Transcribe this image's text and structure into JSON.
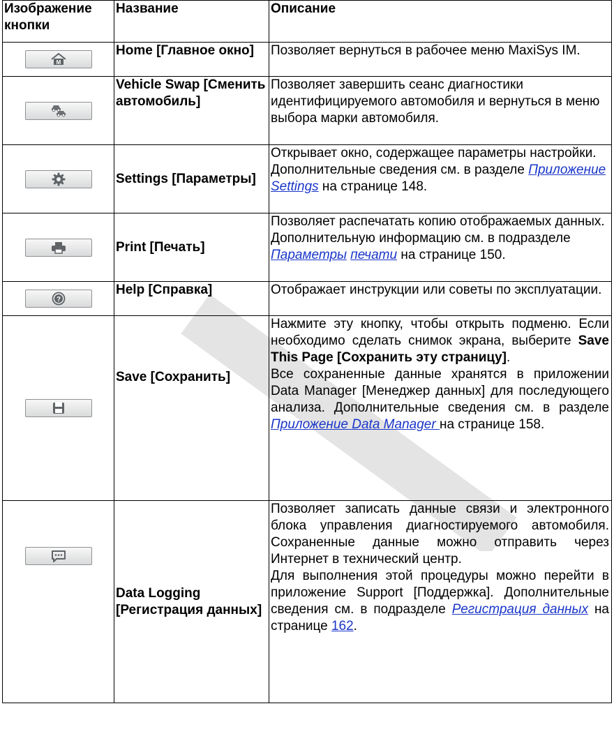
{
  "headers": {
    "image": "Изображение кнопки",
    "name": "Название",
    "desc": "Описание"
  },
  "rows": {
    "home": {
      "icon": "home-icon",
      "name": "Home [Главное окно]",
      "desc": "Позволяет вернуться в рабочее меню MaxiSys IM."
    },
    "vehicle_swap": {
      "icon": "vehicle-swap-icon",
      "name": "Vehicle Swap [Сменить автомобиль]",
      "desc": "Позволяет завершить сеанс диагностики идентифицируемого автомобиля и вернуться в меню выбора марки автомобиля."
    },
    "settings": {
      "icon": "gear-icon",
      "name": "Settings [Параметры]",
      "desc_a": "Открывает окно, содержащее параметры настройки. Дополнительные сведения см. в разделе ",
      "link": "Приложение Settings",
      "desc_b": " на странице 148."
    },
    "print": {
      "icon": "printer-icon",
      "name": "Print [Печать]",
      "desc_a": "Позволяет распечатать копию отображаемых данных. Дополнительную информацию см. в подразделе ",
      "link1": "Параметры",
      "link2": "печати",
      "desc_b": " на странице 150."
    },
    "help": {
      "icon": "help-icon",
      "name": "Help [Справка]",
      "desc": "Отображает инструкции или советы по эксплуатации."
    },
    "save": {
      "icon": "floppy-disk-icon",
      "name": "Save [Сохранить]",
      "p1_a": "Нажмите эту кнопку, чтобы открыть подменю. Если необходимо сделать снимок экрана, выберите ",
      "p1_bold": "Save This Page [Сохранить эту страницу]",
      "p1_end": ".",
      "p2_a": "Все сохраненные данные хранятся в приложении Data Manager [Менеджер данных] для последующего анализа. Дополнительные сведения см. в разделе ",
      "p2_link": "Приложение Data Manager ",
      "p2_b": "на странице 158."
    },
    "data_logging": {
      "icon": "chat-message-icon",
      "name": "Data Logging [Регистрация данных]",
      "p1": "Позволяет записать данные связи и электронного блока управления диагностируемого автомобиля. Сохраненные данные можно отправить через Интернет в технический центр.",
      "p2_a": "Для выполнения этой процедуры можно перейти в приложение Support [Поддержка]. Дополнительные сведения см. в подразделе ",
      "p2_link": "Регистрация данных",
      "p2_b": " на странице ",
      "p2_page": "162",
      "p2_end": "."
    }
  },
  "watermark": "AUTEL",
  "colors": {
    "link": "#1a36c8",
    "border": "#000000",
    "watermark": "#e6e6e6"
  }
}
